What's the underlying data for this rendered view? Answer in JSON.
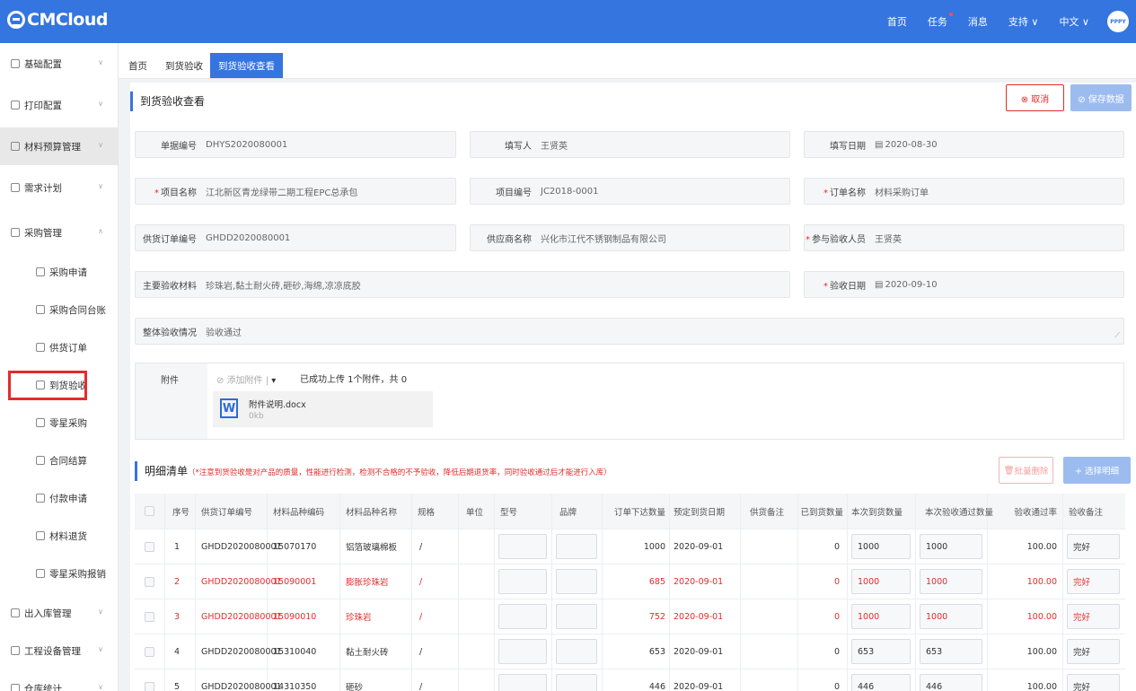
{
  "app": {
    "logo": "CMCloud",
    "nav": [
      "首页",
      "任务",
      "消息",
      "支持 ∨",
      "中文 ∨"
    ],
    "avatar_text": "PPPY"
  },
  "sidebar": {
    "items": [
      {
        "label": "基础配置",
        "level": 1,
        "chevron": "∨"
      },
      {
        "label": "打印配置",
        "level": 1,
        "chevron": "∨"
      },
      {
        "label": "材料预算管理",
        "level": 1,
        "chevron": "∨"
      },
      {
        "label": "需求计划",
        "level": 1,
        "chevron": "∨"
      },
      {
        "label": "采购管理",
        "level": 1,
        "chevron": "∧"
      },
      {
        "label": "采购申请",
        "level": 2
      },
      {
        "label": "采购合同台账",
        "level": 2
      },
      {
        "label": "供货订单",
        "level": 2
      },
      {
        "label": "到货验收",
        "level": 2
      },
      {
        "label": "零星采购",
        "level": 2
      },
      {
        "label": "合同结算",
        "level": 2
      },
      {
        "label": "付款申请",
        "level": 2
      },
      {
        "label": "材料退货",
        "level": 2
      },
      {
        "label": "零星采购报销",
        "level": 2
      },
      {
        "label": "出入库管理",
        "level": 1,
        "chevron": "∨"
      },
      {
        "label": "工程设备管理",
        "level": 1,
        "chevron": "∨"
      },
      {
        "label": "仓库统计",
        "level": 1,
        "chevron": "∨"
      }
    ]
  },
  "tabs": [
    "首页",
    "到货验收",
    "到货验收查看"
  ],
  "page": {
    "title": "到货验收查看",
    "cancel_label": "⊗ 取消",
    "save_label": "⊘ 保存数据"
  },
  "form": {
    "doc_no_label": "单据编号",
    "doc_no": "DHYS2020080001",
    "writer_label": "填写人",
    "writer": "王贤英",
    "write_date_label": "填写日期",
    "write_date": "2020-08-30",
    "project_name_label": "项目名称",
    "project_name": "江北新区青龙绿带二期工程EPC总承包",
    "project_no_label": "项目编号",
    "project_no": "JC2018-0001",
    "order_name_label": "订单名称",
    "order_name": "材料采购订单",
    "supply_order_label": "供货订单编号",
    "supply_order": "GHDD2020080001",
    "supplier_label": "供应商名称",
    "supplier": "兴化市江代不锈钢制品有限公司",
    "inspector_label": "参与验收人员",
    "inspector": "王贤英",
    "materials_label": "主要验收材料",
    "materials": "珍珠岩,黏土耐火砖,砸砂,海绵,凉凉底胶",
    "inspect_date_label": "验收日期",
    "inspect_date": "2020-09-10",
    "overall_label": "整体验收情况",
    "overall": "验收通过"
  },
  "attachment": {
    "label": "附件",
    "add_label": "添加附件",
    "count_text": "已成功上传 1个附件，共 0",
    "file_name": "附件说明.docx",
    "file_size": "0kb",
    "file_icon": "W"
  },
  "detail": {
    "title": "明细清单",
    "note": "（*注意到货验收是对产品的质量，性能进行检测，检测不合格的不予验收，降低后期退货率，同时验收通过后才能进行入库）",
    "batch_delete_label": "批量删除",
    "choose_label": "+ 选择明细",
    "columns": [
      "序号",
      "供货订单编号",
      "材料品种编码",
      "材料品种名称",
      "规格",
      "单位",
      "型号",
      "品牌",
      "订单下达数量",
      "预定到货日期",
      "供货备注",
      "已到货数量",
      "本次到货数量",
      "本次验收通过数量",
      "验收通过率",
      "验收备注"
    ],
    "rows": [
      {
        "no": "1",
        "order": "GHDD2020080001",
        "code": "15070170",
        "name": "铝箔玻璃棉板",
        "spec": "/",
        "unit": "",
        "model": "",
        "brand": "",
        "qty": "1000",
        "date": "2020-09-01",
        "remark": "",
        "arrived": "0",
        "this_arrive": "1000",
        "this_pass": "1000",
        "rate": "100.00",
        "check_note": "完好",
        "red": false
      },
      {
        "no": "2",
        "order": "GHDD2020080001",
        "code": "15090001",
        "name": "膨胀珍珠岩",
        "spec": "/",
        "unit": "",
        "model": "",
        "brand": "",
        "qty": "685",
        "date": "2020-09-01",
        "remark": "",
        "arrived": "0",
        "this_arrive": "1000",
        "this_pass": "1000",
        "rate": "100.00",
        "check_note": "完好",
        "red": true
      },
      {
        "no": "3",
        "order": "GHDD2020080001",
        "code": "15090010",
        "name": "珍珠岩",
        "spec": "/",
        "unit": "",
        "model": "",
        "brand": "",
        "qty": "752",
        "date": "2020-09-01",
        "remark": "",
        "arrived": "0",
        "this_arrive": "1000",
        "this_pass": "1000",
        "rate": "100.00",
        "check_note": "完好",
        "red": true
      },
      {
        "no": "4",
        "order": "GHDD2020080001",
        "code": "15310040",
        "name": "黏土耐火砖",
        "spec": "/",
        "unit": "",
        "model": "",
        "brand": "",
        "qty": "653",
        "date": "2020-09-01",
        "remark": "",
        "arrived": "0",
        "this_arrive": "653",
        "this_pass": "653",
        "rate": "100.00",
        "check_note": "完好",
        "red": false
      },
      {
        "no": "5",
        "order": "GHDD2020080001",
        "code": "14310350",
        "name": "砸砂",
        "spec": "/",
        "unit": "",
        "model": "",
        "brand": "",
        "qty": "446",
        "date": "2020-09-01",
        "remark": "",
        "arrived": "0",
        "this_arrive": "446",
        "this_pass": "446",
        "rate": "100.00",
        "check_note": "完好",
        "red": false
      }
    ]
  },
  "colors": {
    "brand": "#3475e0",
    "danger": "#e52b2b"
  }
}
